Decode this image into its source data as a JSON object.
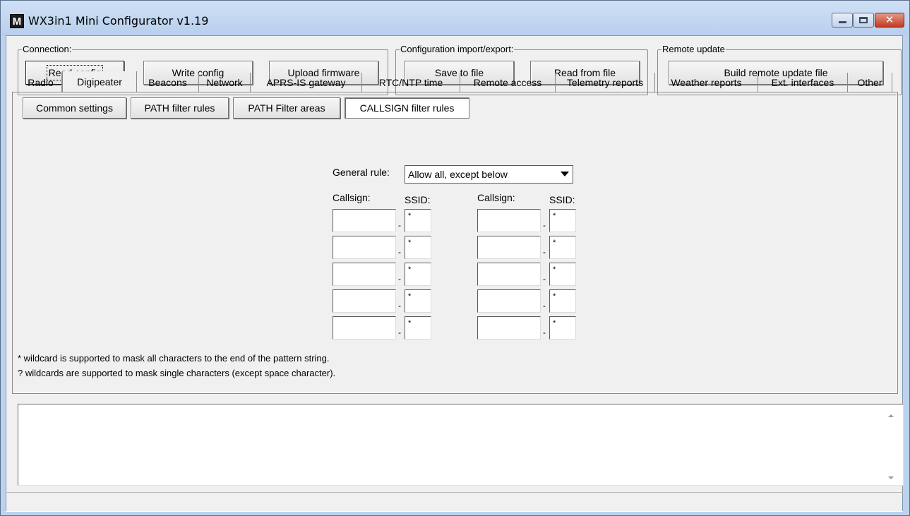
{
  "window": {
    "title": "WX3in1 Mini Configurator v1.19",
    "app_icon_letter": "M",
    "controls": {
      "close_glyph": "✕"
    }
  },
  "connection": {
    "legend": "Connection:",
    "read_config": "Read config",
    "write_config": "Write config",
    "upload_firmware": "Upload firmware"
  },
  "config_io": {
    "legend": "Configuration import/export:",
    "save_to_file": "Save to file",
    "read_from_file": "Read from file"
  },
  "remote_update": {
    "legend": "Remote update",
    "build": "Build remote update file"
  },
  "tabs": [
    "Radio",
    "Digipeater",
    "Beacons",
    "Network",
    "APRS-IS gateway",
    "RTC/NTP time",
    "Remote access",
    "Telemetry reports",
    "Weather reports",
    "Ext. interfaces",
    "Other"
  ],
  "active_tab": "Digipeater",
  "subtabs": [
    "Common settings",
    "PATH filter rules",
    "PATH Filter areas",
    "CALLSIGN filter rules"
  ],
  "active_subtab": "CALLSIGN filter rules",
  "callsign_filter": {
    "general_rule_label": "General rule:",
    "general_rule_value": "Allow all, except below",
    "callsign_header": "Callsign:",
    "ssid_header": "SSID:",
    "separator": "-",
    "rows_left": [
      {
        "callsign": "",
        "ssid": "*"
      },
      {
        "callsign": "",
        "ssid": "*"
      },
      {
        "callsign": "",
        "ssid": "*"
      },
      {
        "callsign": "",
        "ssid": "*"
      },
      {
        "callsign": "",
        "ssid": "*"
      }
    ],
    "rows_right": [
      {
        "callsign": "",
        "ssid": "*"
      },
      {
        "callsign": "",
        "ssid": "*"
      },
      {
        "callsign": "",
        "ssid": "*"
      },
      {
        "callsign": "",
        "ssid": "*"
      },
      {
        "callsign": "",
        "ssid": "*"
      }
    ],
    "note_1": "* wildcard is supported to mask all characters to the end of the pattern string.",
    "note_2": "? wildcards are supported to mask single characters (except space character)."
  },
  "log": {
    "text": ""
  },
  "status_bar": {
    "text": ""
  }
}
